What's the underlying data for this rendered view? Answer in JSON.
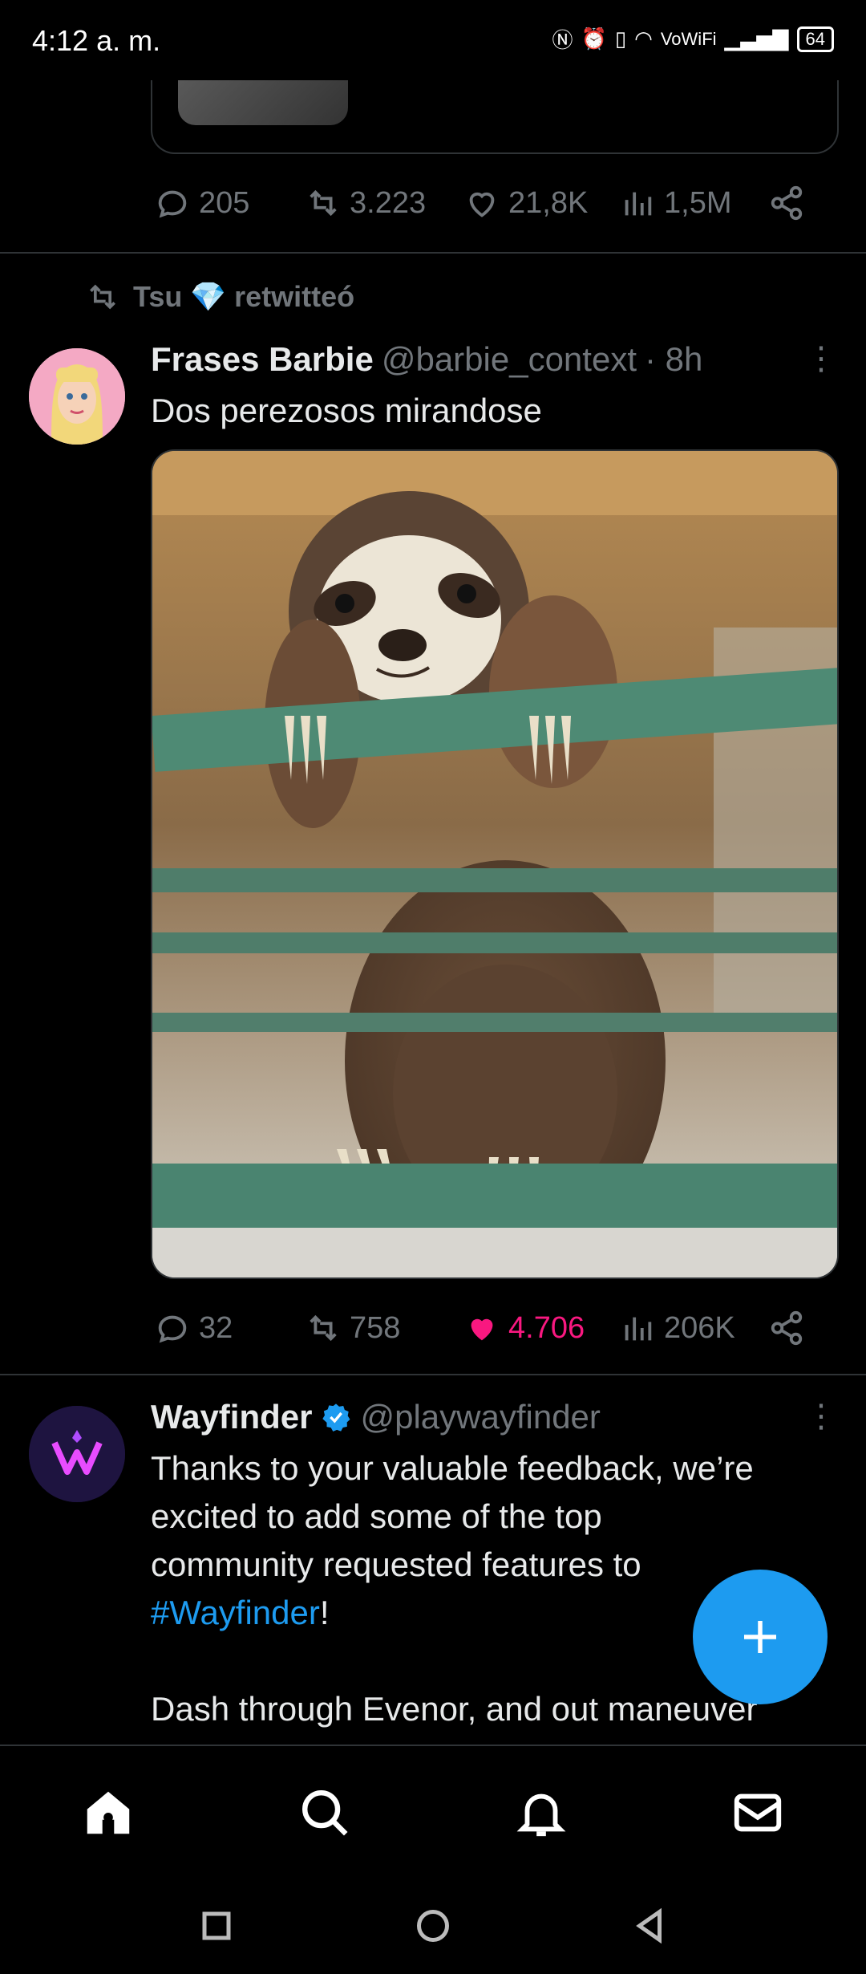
{
  "status_bar": {
    "time": "4:12 a. m.",
    "network": "VoWiFi",
    "battery": "64"
  },
  "prev_tweet": {
    "stats": {
      "replies": "205",
      "retweets": "3.223",
      "likes": "21,8K",
      "views": "1,5M"
    }
  },
  "retweet_context": {
    "label": "Tsu 💎 retwitteó"
  },
  "tweet1": {
    "name": "Frases Barbie",
    "handle": "@barbie_context",
    "time": "· 8h",
    "text": "Dos perezosos mirandose",
    "image_alt": "sloth-photo",
    "stats": {
      "replies": "32",
      "retweets": "758",
      "likes": "4.706",
      "views": "206K"
    },
    "liked": true
  },
  "tweet2": {
    "name": "Wayfinder",
    "handle": "@playwayfinder",
    "text_line1": "Thanks to your valuable feedback, we’re",
    "text_line2": "excited to add some of the top",
    "text_line3": "community requested features to",
    "hashtag": "#Wayfinder",
    "hashtag_suffix": "!",
    "text_line5": "Dash through Evenor, and out maneuver",
    "verified": true
  },
  "colors": {
    "accent": "#1d9bf0",
    "like": "#f91880",
    "muted": "#71767b",
    "text": "#e7e9ea",
    "background": "#000000"
  },
  "nav": [
    "home-icon",
    "search-icon",
    "notifications-icon",
    "messages-icon"
  ]
}
